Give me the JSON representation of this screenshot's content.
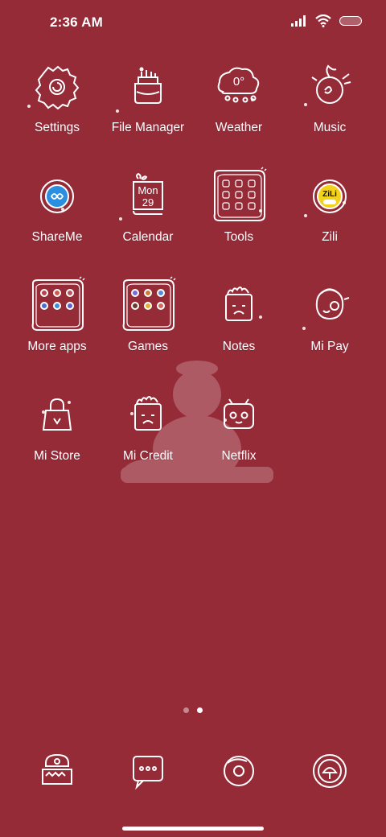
{
  "status_bar": {
    "time": "2:36 AM"
  },
  "apps": [
    {
      "label": "Settings"
    },
    {
      "label": "File Manager"
    },
    {
      "label": "Weather",
      "badge_text": "0°"
    },
    {
      "label": "Music"
    },
    {
      "label": "ShareMe"
    },
    {
      "label": "Calendar",
      "day": "Mon",
      "date": "29"
    },
    {
      "label": "Tools"
    },
    {
      "label": "Zili",
      "badge_text": "ZiLi"
    },
    {
      "label": "More apps"
    },
    {
      "label": "Games"
    },
    {
      "label": "Notes"
    },
    {
      "label": "Mi Pay"
    },
    {
      "label": "Mi Store"
    },
    {
      "label": "Mi Credit"
    },
    {
      "label": "Netflix"
    }
  ],
  "page_indicator": {
    "total": 2,
    "active": 2
  },
  "colors": {
    "background": "#962b38",
    "icon_line": "#ffffff",
    "shareme_blue": "#2a8fe0",
    "zili_yellow": "#f2d21b"
  }
}
